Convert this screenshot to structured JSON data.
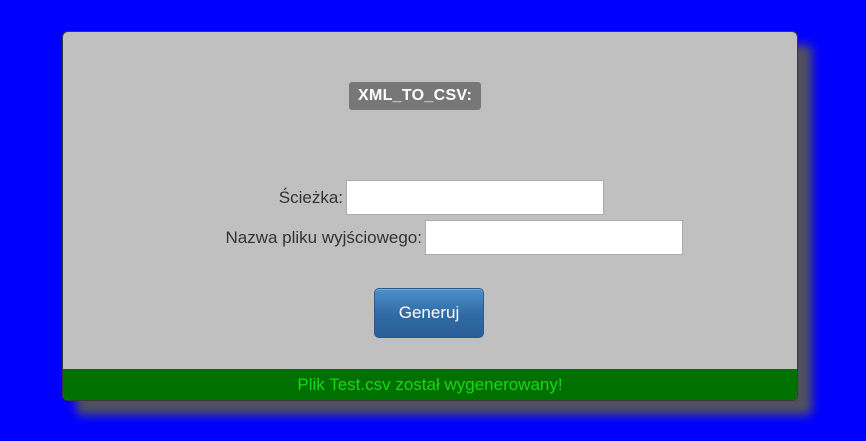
{
  "colors": {
    "page_background": "#0000ff",
    "panel_background": "#c0c0c0",
    "title_badge": "#777777",
    "button": "#2f6aa5",
    "status_bar_background": "#007000",
    "status_text": "#19d619"
  },
  "panel": {
    "title": "XML_TO_CSV:"
  },
  "form": {
    "path_label": "Ścieżka:",
    "path_value": "",
    "output_label": "Nazwa pliku wyjściowego:",
    "output_value": ""
  },
  "actions": {
    "generate_label": "Generuj"
  },
  "status": {
    "message": "Plik Test.csv został wygenerowany!"
  }
}
